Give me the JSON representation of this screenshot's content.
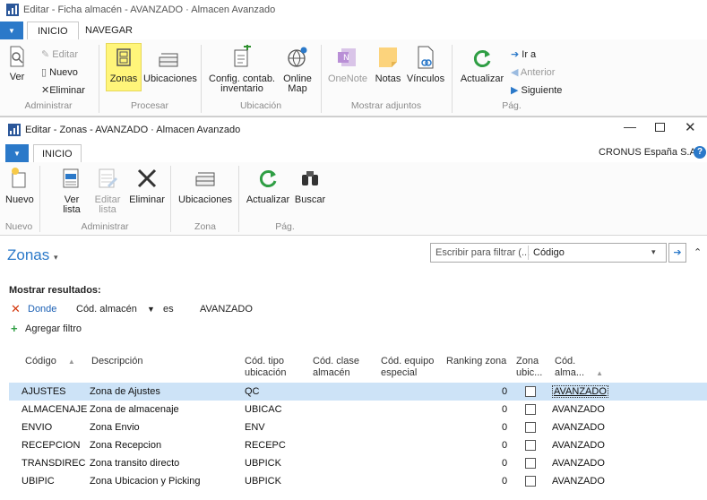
{
  "outer_window": {
    "title": "Editar - Ficha almacén - AVANZADO · Almacen Avanzado",
    "tabs": [
      "INICIO",
      "NAVEGAR"
    ],
    "ribbon": {
      "ver": "Ver",
      "editar": "Editar",
      "nuevo": "Nuevo",
      "eliminar": "Eliminar",
      "zonas": "Zonas",
      "ubicaciones": "Ubicaciones",
      "config_line1": "Config. contab.",
      "config_line2": "inventario",
      "online_line1": "Online",
      "online_line2": "Map",
      "onenote": "OneNote",
      "notas": "Notas",
      "vinculos": "Vínculos",
      "actualizar": "Actualizar",
      "ir_a": "Ir a",
      "anterior": "Anterior",
      "siguiente": "Siguiente",
      "groups": [
        "Administrar",
        "Procesar",
        "Ubicación",
        "Mostrar adjuntos",
        "Pág."
      ]
    }
  },
  "inner_window": {
    "title": "Editar - Zonas - AVANZADO · Almacen Avanzado",
    "tab": "INICIO",
    "company": "CRONUS España S.A.",
    "ribbon": {
      "nuevo": "Nuevo",
      "ver_line1": "Ver",
      "ver_line2": "lista",
      "editar_line1": "Editar",
      "editar_line2": "lista",
      "eliminar": "Eliminar",
      "ubicaciones": "Ubicaciones",
      "actualizar": "Actualizar",
      "buscar": "Buscar",
      "groups": [
        "Nuevo",
        "Administrar",
        "Zona",
        "Pág."
      ]
    },
    "page_title": "Zonas",
    "filter": {
      "placeholder": "Escribir para filtrar (... ",
      "field": "Código"
    },
    "results": {
      "heading": "Mostrar resultados:",
      "donde": "Donde",
      "field": "Cód. almacén",
      "operator": "es",
      "value": "AVANZADO",
      "add_filter": "Agregar filtro"
    },
    "columns": {
      "codigo": "Código",
      "descripcion": "Descripción",
      "tipo_1": "Cód. tipo",
      "tipo_2": "ubicación",
      "clase_1": "Cód. clase",
      "clase_2": "almacén",
      "equipo_1": "Cód. equipo",
      "equipo_2": "especial",
      "ranking": "Ranking zona",
      "zona_1": "Zona",
      "zona_2": "ubic...",
      "alm_1": "Cód.",
      "alm_2": "alma..."
    },
    "rows": [
      {
        "codigo": "AJUSTES",
        "descripcion": "Zona de Ajustes",
        "tipo": "QC",
        "ranking": "0",
        "almacen": "AVANZADO"
      },
      {
        "codigo": "ALMACENAJE",
        "descripcion": "Zona de almacenaje",
        "tipo": "UBICAC",
        "ranking": "0",
        "almacen": "AVANZADO"
      },
      {
        "codigo": "ENVIO",
        "descripcion": "Zona Envio",
        "tipo": "ENV",
        "ranking": "0",
        "almacen": "AVANZADO"
      },
      {
        "codigo": "RECEPCION",
        "descripcion": "Zona Recepcion",
        "tipo": "RECEPC",
        "ranking": "0",
        "almacen": "AVANZADO"
      },
      {
        "codigo": "TRANSDIREC",
        "descripcion": "Zona transito directo",
        "tipo": "UBPICK",
        "ranking": "0",
        "almacen": "AVANZADO"
      },
      {
        "codigo": "UBIPIC",
        "descripcion": "Zona Ubicacion y Picking",
        "tipo": "UBPICK",
        "ranking": "0",
        "almacen": "AVANZADO"
      }
    ]
  },
  "colors": {
    "accent": "#2b79c9",
    "selected_row": "#cde3f7",
    "highlight": "#fff57a"
  }
}
